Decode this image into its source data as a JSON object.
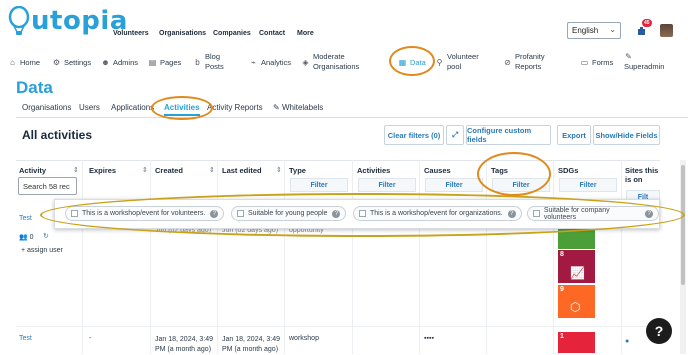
{
  "brand": {
    "name": "utopia",
    "color": "#2aa0d8"
  },
  "topnav": {
    "volunteers": "Volunteers",
    "organisations": "Organisations",
    "companies": "Companies",
    "contact": "Contact",
    "more": "More"
  },
  "language": {
    "selected": "English"
  },
  "notifications": {
    "count": "45"
  },
  "secnav": {
    "home": "Home",
    "settings": "Settings",
    "admins": "Admins",
    "pages": "Pages",
    "blog1": "Blog",
    "blog2": "Posts",
    "analytics": "Analytics",
    "mod1": "Moderate",
    "mod2": "Organisations",
    "data": "Data",
    "vol1": "Volunteer",
    "vol2": "pool",
    "prof1": "Profanity",
    "prof2": "Reports",
    "forms": "Forms",
    "superadmin": "Superadmin"
  },
  "page": {
    "title": "Data"
  },
  "tabs": {
    "organisations": "Organisations",
    "users": "Users",
    "applications": "Applications",
    "activities": "Activities",
    "activity_reports": "Activity Reports",
    "whitelabels": "Whitelabels"
  },
  "section": {
    "title": "All activities"
  },
  "buttons": {
    "clear_filters": "Clear filters (0)",
    "configure": "Configure custom fields",
    "export": "Export",
    "show_hide": "Show/Hide Fields"
  },
  "columns": {
    "activity": "Activity",
    "expires": "Expires",
    "created": "Created",
    "last_edited": "Last edited",
    "type": "Type",
    "activities": "Activities",
    "causes": "Causes",
    "tags": "Tags",
    "sdgs": "SDGs",
    "sites1": "Sites this",
    "sites2": "is on"
  },
  "search": {
    "placeholder": "Search 58 rec"
  },
  "filter_label": "Filter",
  "filter_partial": "Filt",
  "tag_options": {
    "t1": "This is a workshop/event for volunteers.",
    "t2": "Suitable for young people",
    "t3": "This is a workshop/event for organizations.",
    "t4": "Suitable for company volunteers"
  },
  "rows": {
    "r1": {
      "name": "Test",
      "volunteers": "0",
      "assign": "+ assign user",
      "created_partial": "Jun (02 days ago)",
      "edited_partial": "Jun (02 days ago)",
      "type_partial": "opportunity"
    },
    "r2": {
      "name": "Test",
      "expires": "-",
      "created1": "Jan 18, 2024, 3:49",
      "created2": "PM (a month ago)",
      "edited1": "Jan 18, 2024, 3:49",
      "edited2": "PM (a month ago)",
      "type": "workshop"
    }
  },
  "sdg_colors": {
    "sdg_top": "#4c9f38",
    "sdg8": "#a21942",
    "sdg9": "#fd6925",
    "sdg11": "#fd9d24",
    "sdg1": "#e5243b"
  },
  "sdg_labels": {
    "s8": "8",
    "s9": "9",
    "s1": "1"
  },
  "help": {
    "label": "?"
  },
  "highlight_color": "#e0891c"
}
